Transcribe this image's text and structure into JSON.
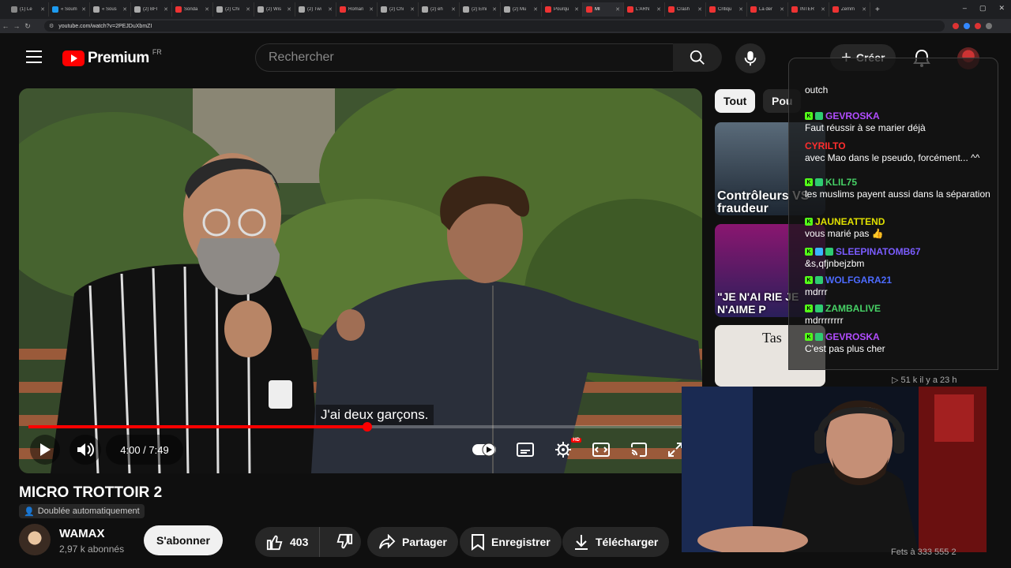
{
  "browser": {
    "tabs": [
      {
        "label": "(1) Le",
        "color": "#888"
      },
      {
        "label": "« Soum",
        "color": "#1d9bf0"
      },
      {
        "label": "« Sous",
        "color": "#aaa"
      },
      {
        "label": "(2) BFI",
        "color": "#aaa"
      },
      {
        "label": "Sonda",
        "color": "#e33"
      },
      {
        "label": "(2) Chi",
        "color": "#aaa"
      },
      {
        "label": "(2) Wis",
        "color": "#aaa"
      },
      {
        "label": "(2) Twi",
        "color": "#aaa"
      },
      {
        "label": "Roman",
        "color": "#e33"
      },
      {
        "label": "(2) Chi",
        "color": "#aaa"
      },
      {
        "label": "(2) eh",
        "color": "#aaa"
      },
      {
        "label": "(2) Emi",
        "color": "#aaa"
      },
      {
        "label": "(2) Mu",
        "color": "#aaa"
      },
      {
        "label": "Pourqu",
        "color": "#e33"
      },
      {
        "label": "MI",
        "color": "#e33",
        "active": true
      },
      {
        "label": "L'ARN",
        "color": "#e33"
      },
      {
        "label": "Crash",
        "color": "#e33"
      },
      {
        "label": "Critiqu",
        "color": "#e33"
      },
      {
        "label": "La der",
        "color": "#e33"
      },
      {
        "label": "INTER",
        "color": "#e33"
      },
      {
        "label": "Zemm",
        "color": "#e33"
      }
    ],
    "url": "youtube.com/watch?v=2PEJDuXbmZI",
    "new_tab": "+"
  },
  "header": {
    "logo_text": "Premium",
    "region": "FR",
    "search_placeholder": "Rechercher",
    "create_label": "Créer"
  },
  "player": {
    "caption": "J'ai deux garçons.",
    "time": "4:00 / 7:49",
    "progress_fraction": 0.5106,
    "hd": "HD"
  },
  "video": {
    "title": "MICRO TROTTOIR 2",
    "dubbed": "Doublée automatiquement",
    "channel": "WAMAX",
    "subscribers": "2,97 k abonnés",
    "subscribe_label": "S'abonner",
    "likes": "403",
    "share_label": "Partager",
    "save_label": "Enregistrer",
    "download_label": "Télécharger"
  },
  "sidebar": {
    "chips": [
      "Tout",
      "Pou"
    ],
    "thumbs": [
      {
        "title": "Contrôleurs VS fraudeur"
      },
      {
        "title": "\"JE N'AI RIE JE N'AIME P"
      },
      {
        "title": "Tas"
      }
    ],
    "meta": "▷ 51 k   il y a 23 h"
  },
  "chat": {
    "messages": [
      {
        "user": "",
        "text": "outch",
        "color": "#ffffff",
        "badges": []
      },
      {
        "user": "GEVROSKA",
        "text": "Faut réussir à se marier déjà",
        "color": "#b24dff",
        "badges": [
          "K",
          "G"
        ]
      },
      {
        "user": "CYRILTO",
        "text": "avec Mao dans le pseudo, forcément... ^^",
        "color": "#ff2d2d",
        "badges": []
      },
      {
        "user": "KLIL75",
        "text": "les muslims payent aussi dans la séparation",
        "color": "#47d166",
        "badges": [
          "K",
          "G"
        ]
      },
      {
        "user": "JAUNEATTEND",
        "text": "vous marié pas 👍",
        "color": "#e0e000",
        "badges": [
          "K"
        ]
      },
      {
        "user": "SLEEPINATOMB67",
        "text": "&s,qfjnbejzbm",
        "color": "#7a5cff",
        "badges": [
          "K",
          "B",
          "G"
        ]
      },
      {
        "user": "WOLFGARA21",
        "text": "mdrrr",
        "color": "#4d6bff",
        "badges": [
          "K",
          "G"
        ]
      },
      {
        "user": "ZAMBALIVE",
        "text": "mdrrrrrrrr",
        "color": "#47d166",
        "badges": [
          "K",
          "G"
        ]
      },
      {
        "user": "GEVROSKA",
        "text": "C'est pas plus cher",
        "color": "#b24dff",
        "badges": [
          "K",
          "G"
        ]
      }
    ]
  },
  "webcam_caption": "Fets à 333 555 2"
}
